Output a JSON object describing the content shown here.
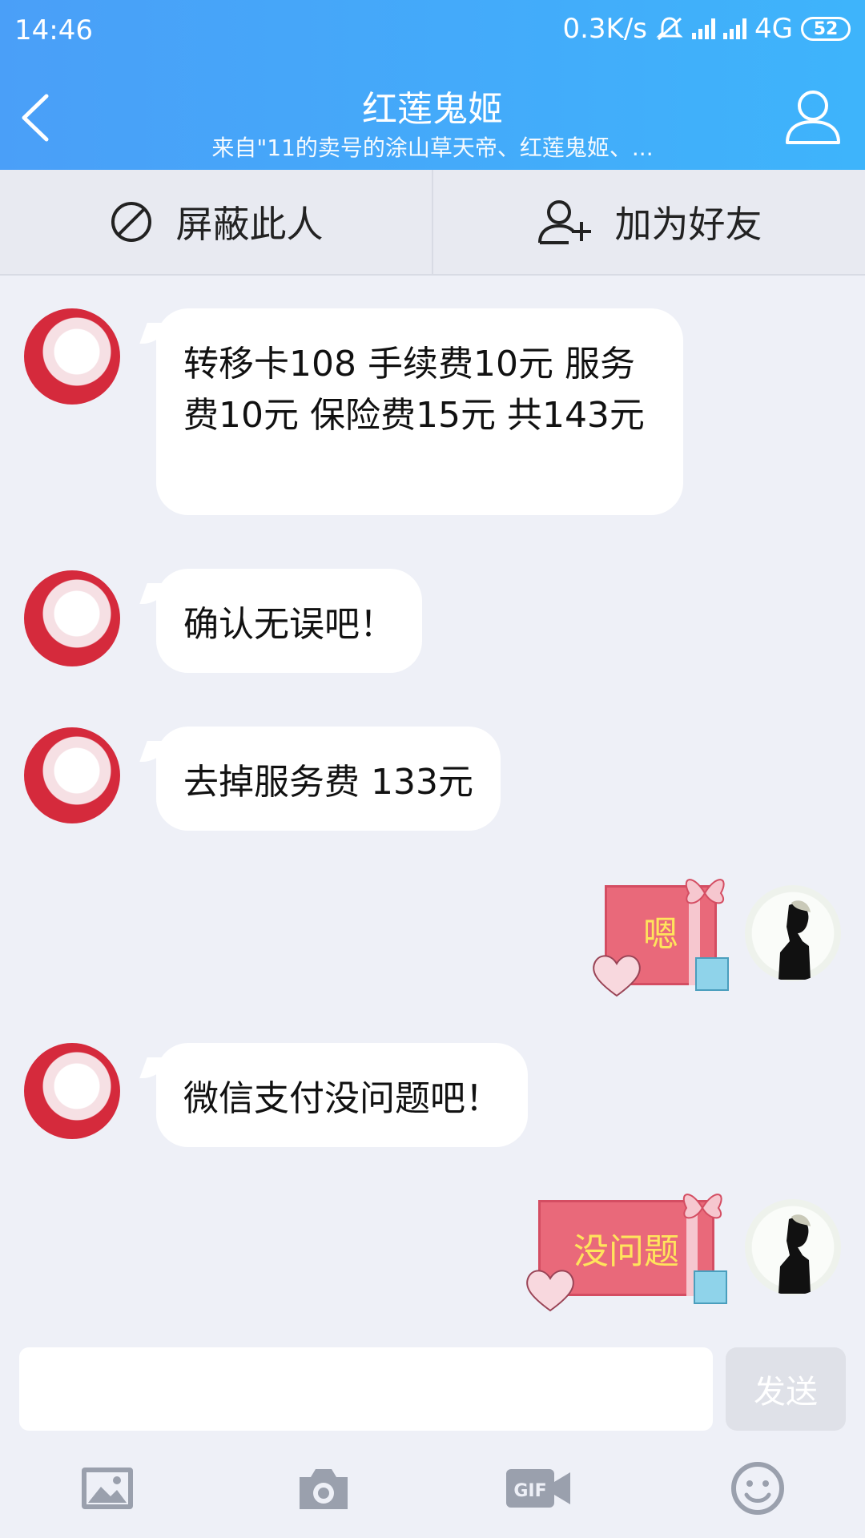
{
  "status_bar": {
    "time": "14:46",
    "net_speed": "0.3K/s",
    "network": "4G",
    "battery": "52"
  },
  "header": {
    "title": "红莲鬼姬",
    "subtitle": "来自\"11的卖号的涂山草天帝、红莲鬼姬、..."
  },
  "actions": {
    "block_label": "屏蔽此人",
    "add_friend_label": "加为好友"
  },
  "messages": [
    {
      "from": "them",
      "text": "转移卡108 手续费10元   服务费10元 保险费15元 共143元"
    },
    {
      "from": "them",
      "text": "确认无误吧！"
    },
    {
      "from": "them",
      "text": "去掉服务费 133元"
    },
    {
      "from": "me",
      "sticker_text": "嗯"
    },
    {
      "from": "them",
      "text": "微信支付没问题吧！"
    },
    {
      "from": "me",
      "sticker_text": "没问题"
    }
  ],
  "input": {
    "placeholder": "",
    "send_label": "发送"
  },
  "toolbar": {
    "icons": [
      "image-icon",
      "camera-icon",
      "gif-icon",
      "emoji-icon"
    ]
  },
  "colors": {
    "header_start": "#4a9ff8",
    "header_end": "#3eb4fb",
    "background": "#eef0f7",
    "sticker_red": "#e9697a",
    "sticker_text": "#ffe45c"
  }
}
